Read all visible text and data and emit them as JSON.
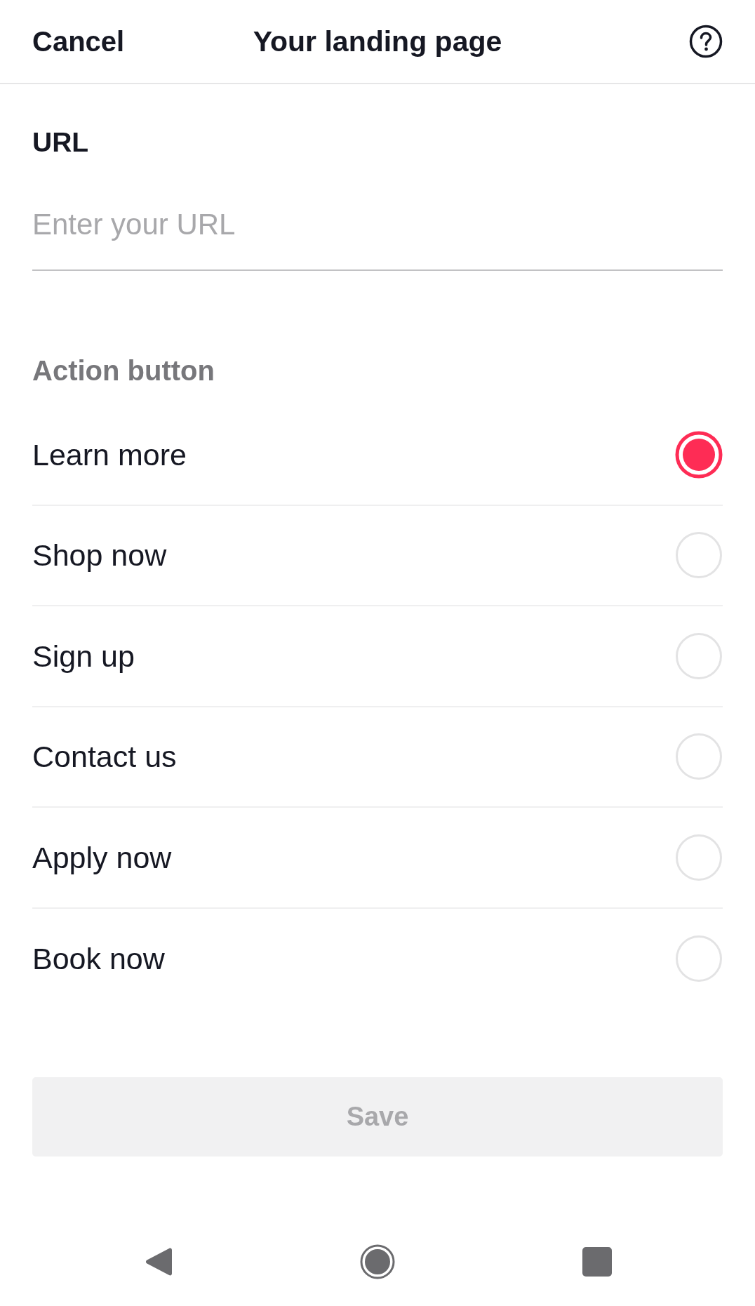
{
  "header": {
    "cancel": "Cancel",
    "title": "Your landing page"
  },
  "url": {
    "label": "URL",
    "placeholder": "Enter your URL"
  },
  "action_button": {
    "label": "Action button",
    "options": [
      {
        "label": "Learn more",
        "selected": true
      },
      {
        "label": "Shop now",
        "selected": false
      },
      {
        "label": "Sign up",
        "selected": false
      },
      {
        "label": "Contact us",
        "selected": false
      },
      {
        "label": "Apply now",
        "selected": false
      },
      {
        "label": "Book now",
        "selected": false
      }
    ]
  },
  "save_button": {
    "label": "Save",
    "disabled": true
  }
}
